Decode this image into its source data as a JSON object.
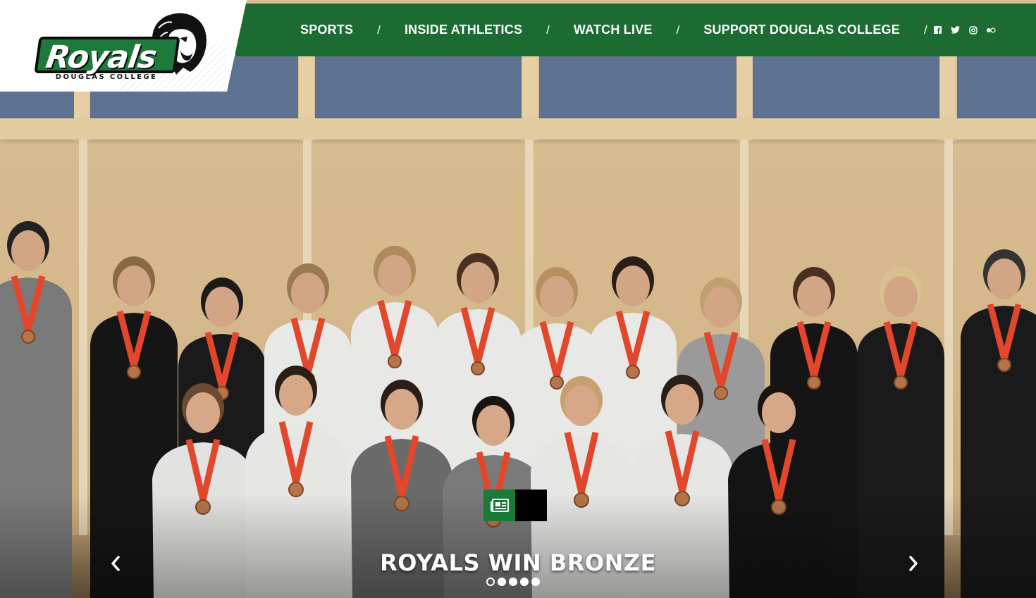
{
  "logo": {
    "wordmark": "Royals",
    "subtitle": "DOUGLAS COLLEGE"
  },
  "nav": {
    "items": [
      {
        "label": "SPORTS"
      },
      {
        "label": "INSIDE ATHLETICS"
      },
      {
        "label": "WATCH LIVE"
      },
      {
        "label": "SUPPORT DOUGLAS COLLEGE"
      }
    ],
    "separator": "/",
    "social": [
      "facebook-icon",
      "twitter-icon",
      "instagram-icon",
      "flickr-icon"
    ]
  },
  "hero": {
    "slide_title": "ROYALS WIN BRONZE",
    "slide_count": 5,
    "active_slide": 1,
    "category_icon": "newspaper-icon"
  },
  "colors": {
    "brand_green": "#1b6b33",
    "tag_green": "#1b7a3a",
    "white": "#ffffff"
  }
}
